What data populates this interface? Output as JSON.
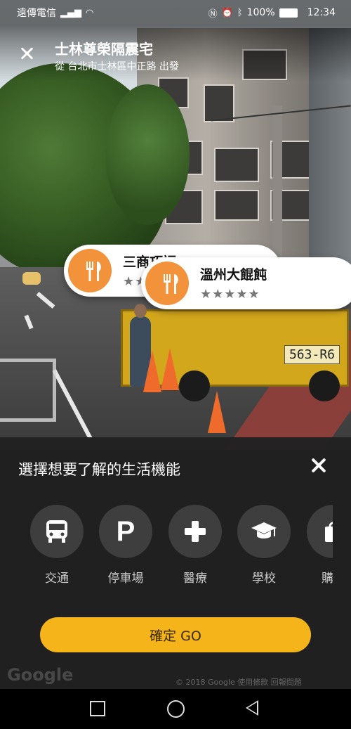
{
  "status_bar": {
    "carrier": "遠傳電信",
    "battery": "100%",
    "time": "12:34"
  },
  "header": {
    "title": "士林尊榮隔震宅",
    "subtitle": "從 台北市士林區中正路 出發"
  },
  "scene": {
    "truck_plate": "563-R6"
  },
  "place_cards": [
    {
      "name": "三商巧福",
      "stars": "★★★★★",
      "icon": "fork-knife-icon"
    },
    {
      "name": "溫州大餛飩",
      "stars": "★★★★★",
      "icon": "fork-knife-icon"
    }
  ],
  "panel": {
    "title": "選擇想要了解的生活機能",
    "categories": [
      {
        "label": "交通",
        "icon": "bus-icon"
      },
      {
        "label": "停車場",
        "icon": "parking-icon"
      },
      {
        "label": "醫療",
        "icon": "medical-cross-icon"
      },
      {
        "label": "學校",
        "icon": "graduation-cap-icon"
      },
      {
        "label": "購物",
        "icon": "shopping-bag-icon"
      }
    ],
    "go_button": "確定 GO"
  },
  "watermark": {
    "google": "Google",
    "copyright": "© 2018 Google   使用條款   回報問題"
  },
  "colors": {
    "accent": "#f5b41a",
    "icon_orange": "#f2923a",
    "panel_bg": "#212121"
  }
}
